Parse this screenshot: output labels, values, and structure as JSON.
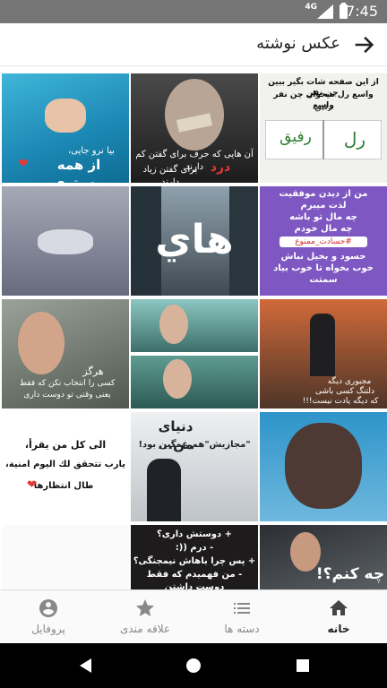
{
  "status": {
    "time": "7:45",
    "network": "4G"
  },
  "appbar": {
    "title": "عکس نوشته"
  },
  "tiles": {
    "t1": {
      "line1": "از این صفحه شات بگیر ببین چن نفر",
      "line2": "واسع رل میخوان چن نفر واسع",
      "line3": "رفیق",
      "left": "رل",
      "right": "رفیق"
    },
    "t2": {
      "line1": "آن هایی که حرف برای گفتن کم دارند",
      "word": "درد",
      "line2": "برای گفتن زیاد دارند"
    },
    "t3": {
      "line1": "بیا نرو جایی،",
      "script": "از همه مهمتری"
    },
    "t4": {
      "line1": "من از دیدن موفقیت",
      "line2": "لذت میبرم",
      "line3": "چه مال تو باشه",
      "line4": "چه مال خودم",
      "tag": "#حسادت_ممنوع",
      "line5": "حسود و بخیل نباش",
      "line6": "خوب بخواه تا خوب بیاد",
      "line7": "سمتت"
    },
    "t5": {
      "word": "هاي"
    },
    "t7": {
      "line1": "مجبوری دیگه",
      "line2": "دلتنگ کسی باشی",
      "line3": "که دیگه یادت نیست!!!"
    },
    "t9": {
      "line1": "هرگز",
      "line2": "کسی را انتخاب نکن که فقط",
      "line3": "یعنی وقتی تو دوست داری"
    },
    "t10": {
      "title": "دنیای من...",
      "line1": "\"مجازیش\"هم غمگین بود!"
    },
    "t11": {
      "line1": "الی کل من یقرأ،",
      "line2": "یارب تتحقق لك اليوم امنية،",
      "line3": "طال انتظارها"
    },
    "t12": {
      "script": "چه کنم؟!"
    },
    "t13": {
      "line1": "+ دوستش داری؟",
      "line2": "- درم ((:",
      "line3": "+ پس چرا باهاش نیمجنگی؟",
      "line4": "- من فهمیدم که فقط دوست داشتن"
    }
  },
  "nav": {
    "home": "خانه",
    "categories": "دسته ها",
    "favorites": "علاقه مندی",
    "profile": "پروفایل"
  }
}
